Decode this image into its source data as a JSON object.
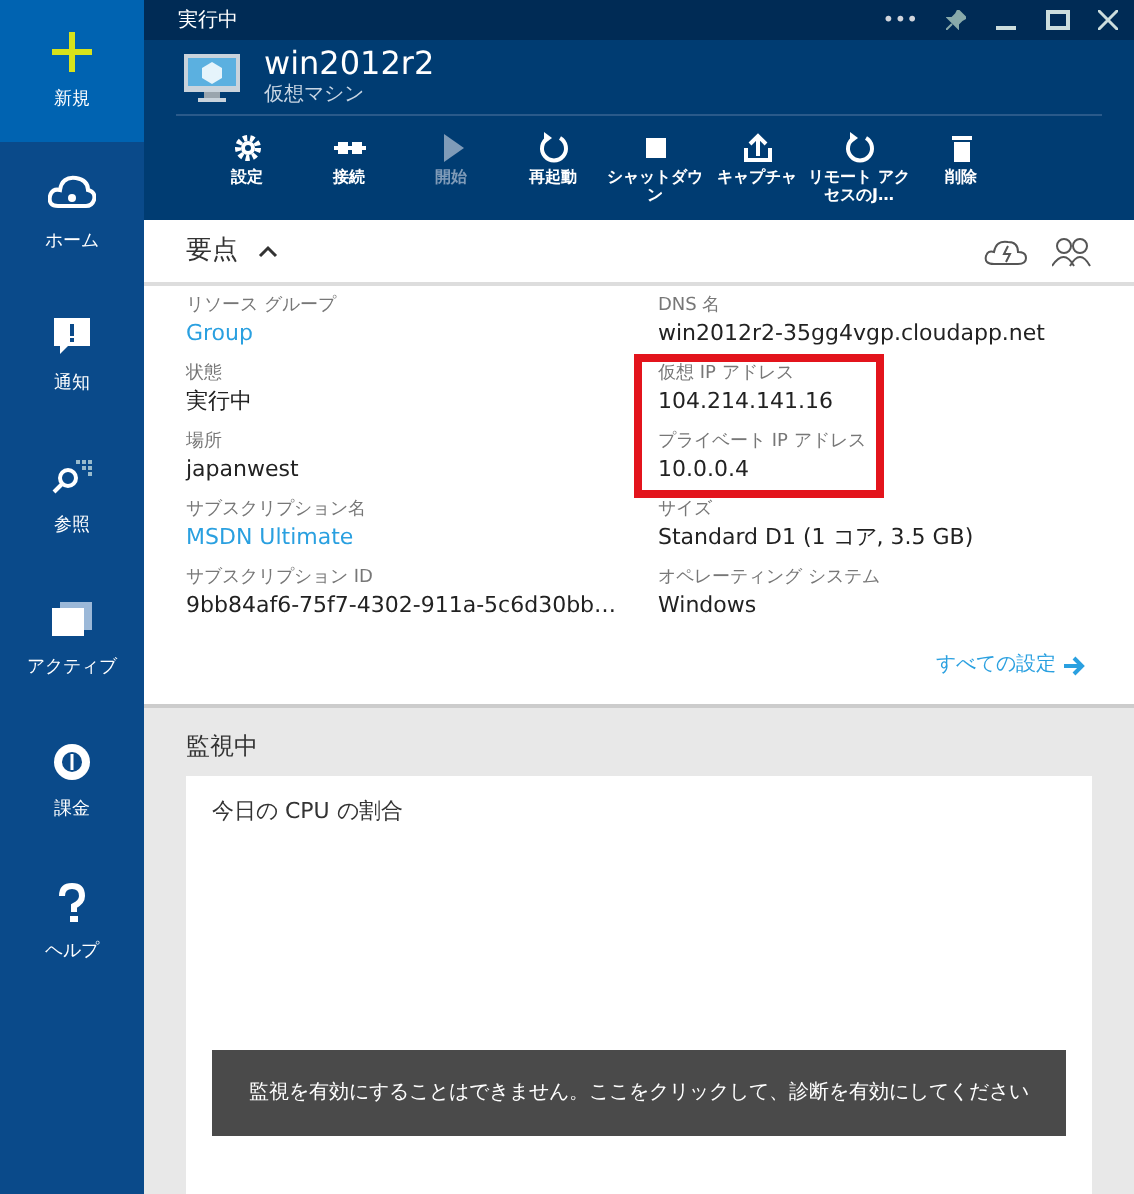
{
  "sidebar": {
    "items": [
      {
        "label": "新規",
        "kind": "new",
        "selected": true
      },
      {
        "label": "ホーム",
        "kind": "home",
        "selected": false
      },
      {
        "label": "通知",
        "kind": "notify",
        "selected": false
      },
      {
        "label": "参照",
        "kind": "browse",
        "selected": false
      },
      {
        "label": "アクティブ",
        "kind": "active",
        "selected": false
      },
      {
        "label": "課金",
        "kind": "billing",
        "selected": false
      },
      {
        "label": "ヘルプ",
        "kind": "help",
        "selected": false
      }
    ]
  },
  "blade": {
    "status": "実行中",
    "more": "•••",
    "title": "win2012r2",
    "subtitle": "仮想マシン",
    "commands": [
      {
        "label": "設定",
        "kind": "settings",
        "disabled": false
      },
      {
        "label": "接続",
        "kind": "connect",
        "disabled": false
      },
      {
        "label": "開始",
        "kind": "start",
        "disabled": true
      },
      {
        "label": "再起動",
        "kind": "restart",
        "disabled": false
      },
      {
        "label": "シャットダウン",
        "kind": "stop",
        "disabled": false
      },
      {
        "label": "キャプチャ",
        "kind": "capture",
        "disabled": false
      },
      {
        "label": "リモート アクセスのJ…",
        "kind": "restart",
        "disabled": false
      },
      {
        "label": "削除",
        "kind": "delete",
        "disabled": false
      }
    ]
  },
  "essentials": {
    "title": "要点",
    "expanded": true,
    "left": [
      {
        "label": "リソース グループ",
        "value": "Group",
        "link": true
      },
      {
        "label": "状態",
        "value": "実行中",
        "link": false
      },
      {
        "label": "場所",
        "value": "japanwest",
        "link": false
      },
      {
        "label": "サブスクリプション名",
        "value": "MSDN Ultimate",
        "link": true
      },
      {
        "label": "サブスクリプション ID",
        "value": "9bb84af6-75f7-4302-911a-5c6d30bb…",
        "link": false
      }
    ],
    "right": [
      {
        "label": "DNS 名",
        "value": "win2012r2-35gg4vgp.cloudapp.net",
        "link": false
      },
      {
        "label": "仮想 IP アドレス",
        "value": "104.214.141.16",
        "link": false
      },
      {
        "label": "プライベート IP アドレス",
        "value": "10.0.0.4",
        "link": false
      },
      {
        "label": "サイズ",
        "value": "Standard D1 (1 コア, 3.5 GB)",
        "link": false
      },
      {
        "label": "オペレーティング システム",
        "value": "Windows",
        "link": false
      }
    ],
    "all_settings": "すべての設定"
  },
  "monitoring": {
    "title": "監視中",
    "card_title": "今日の CPU の割合",
    "banner": "監視を有効にすることはできません。ここをクリックして、診断を有効にしてください"
  }
}
